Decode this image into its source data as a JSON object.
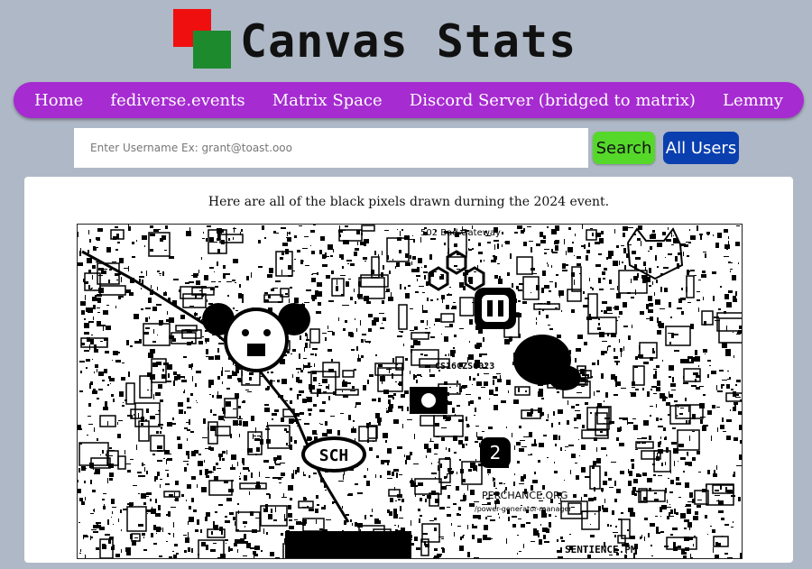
{
  "header": {
    "title": "Canvas Stats",
    "logo_colors": {
      "red": "#f00f0f",
      "green": "#1e8a2e"
    }
  },
  "nav": {
    "items": [
      {
        "label": "Home"
      },
      {
        "label": "fediverse.events"
      },
      {
        "label": "Matrix Space"
      },
      {
        "label": "Discord Server (bridged to matrix)"
      },
      {
        "label": "Lemmy"
      }
    ],
    "color": "#a62bd1"
  },
  "search": {
    "placeholder": "Enter Username Ex: grant@toast.ooo",
    "value": "",
    "search_label": "Search",
    "all_users_label": "All Users"
  },
  "main": {
    "caption": "Here are all of the black pixels drawn durning the 2024 event.",
    "map_labels": [
      "502 Bad Gateway",
      "CS16CZSG023",
      "SENTIENCE.PM",
      "PERCHANCE.ORG",
      "/power-generator-manager"
    ]
  }
}
